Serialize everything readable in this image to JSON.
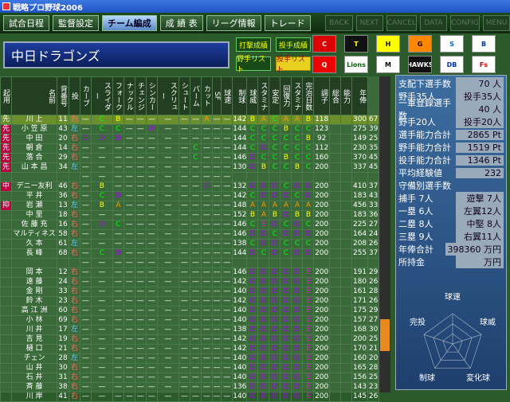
{
  "title": "戦略プロ野球2006",
  "menu": [
    "試合日程",
    "監督設定",
    "チーム編成",
    "成 績 表",
    "リーグ情報",
    "トレード"
  ],
  "active_menu": "チーム編成",
  "system_buttons": [
    "BACK",
    "NEXT",
    "CANCEL",
    "DATA",
    "CONFIG",
    "MENU"
  ],
  "team_name": "中日ドラゴンズ",
  "buttons": {
    "batter_stats": "打撃成績",
    "pitcher_stats": "投手成績",
    "batter_list": "野手リスト",
    "pitcher_list": "投手リスト"
  },
  "logos": [
    "C",
    "T",
    "H",
    "G",
    "S",
    "B",
    "Q",
    "Lions",
    "M",
    "HAWKS",
    "DB",
    "Fs"
  ],
  "headers": [
    "起用",
    "名前",
    "背番号",
    "投",
    "カーブ",
    "スライダー",
    "フォーク",
    "ナックル",
    "チェンジ",
    "シンカー",
    "スクリュー",
    "シュート",
    "パーム",
    "カット",
    "SF",
    "球速",
    "制球",
    "球威",
    "スタミナ",
    "安定",
    "回復力",
    "スタミナ",
    "完治日数",
    "調子",
    "総合",
    "能力",
    "年俸"
  ],
  "rows": [
    [
      "先",
      "川 上",
      11,
      "右",
      "",
      "C",
      "B",
      "",
      "",
      "",
      "",
      "",
      "",
      "A",
      "",
      "",
      "142",
      "B",
      "A",
      "C",
      "A",
      "A",
      "B",
      "118",
      "",
      "",
      "300",
      "67",
      "24000"
    ],
    [
      "先",
      "小 笠 原",
      43,
      "左",
      "",
      "C",
      "C",
      "",
      "",
      "D",
      "",
      "",
      "",
      "",
      "",
      "",
      "144",
      "C",
      "C",
      "C",
      "B",
      "C",
      "C",
      "123",
      "",
      "",
      "275",
      "39",
      "1800"
    ],
    [
      "先",
      "中 田",
      20,
      "右",
      "D",
      "D",
      "D",
      "",
      "",
      "",
      "",
      "",
      "",
      "",
      "",
      "",
      "144",
      "C",
      "C",
      "C",
      "C",
      "C",
      "B",
      "92",
      "",
      "",
      "149",
      "25",
      "1000"
    ],
    [
      "先",
      "朝 倉",
      14,
      "右",
      "",
      "",
      "",
      "",
      "",
      "",
      "",
      "",
      "C",
      "",
      "",
      "",
      "144",
      "C",
      "D",
      "C",
      "C",
      "C",
      "C",
      "112",
      "",
      "",
      "230",
      "35",
      "7000"
    ],
    [
      "先",
      "落 合",
      29,
      "右",
      "",
      "",
      "",
      "",
      "",
      "",
      "",
      "",
      "C",
      "",
      "",
      "",
      "146",
      "D",
      "C",
      "C",
      "B",
      "C",
      "C",
      "160",
      "",
      "",
      "370",
      "45",
      "11000"
    ],
    [
      "先",
      "山 本 昌",
      34,
      "左",
      "",
      "",
      "",
      "",
      "",
      "",
      "",
      "",
      "",
      "",
      "",
      "",
      "130",
      "D",
      "B",
      "C",
      "C",
      "B",
      "C",
      "200",
      "",
      "",
      "337",
      "45",
      "23000"
    ],
    [
      "",
      "",
      "",
      "",
      "",
      "",
      "",
      "",
      "",
      "",
      "",
      "",
      "",
      "",
      "",
      "",
      "",
      "",
      "",
      "",
      "",
      "",
      "",
      "",
      "",
      "",
      "",
      "",
      ""
    ],
    [
      "中",
      "デニー友利",
      46,
      "右",
      "",
      "B",
      "",
      "",
      "",
      "",
      "",
      "",
      "",
      "D",
      "",
      "",
      "132",
      "D",
      "D",
      "D",
      "C",
      "D",
      "D",
      "200",
      "",
      "",
      "410",
      "37",
      "4500"
    ],
    [
      "",
      "平 井",
      36,
      "右",
      "",
      "C",
      "D",
      "",
      "",
      "",
      "",
      "",
      "",
      "",
      "",
      "",
      "142",
      "C",
      "D",
      "D",
      "D",
      "C",
      "D",
      "200",
      "",
      "",
      "183",
      "43",
      "8000"
    ],
    [
      "抑",
      "岩 瀬",
      13,
      "左",
      "",
      "B",
      "A",
      "",
      "",
      "",
      "",
      "",
      "",
      "",
      "",
      "",
      "148",
      "A",
      "A",
      "A",
      "A",
      "A",
      "A",
      "200",
      "",
      "",
      "456",
      "33",
      "30500"
    ],
    [
      "",
      "中 里",
      18,
      "右",
      "",
      "",
      "",
      "",
      "",
      "",
      "",
      "",
      "",
      "",
      "",
      "",
      "152",
      "B",
      "A",
      "B",
      "D",
      "B",
      "B",
      "200",
      "",
      "",
      "183",
      "36",
      "750"
    ],
    [
      "",
      "佐 藤 充",
      16,
      "右",
      "",
      "D",
      "C",
      "",
      "",
      "",
      "",
      "",
      "",
      "",
      "",
      "",
      "146",
      "C",
      "E",
      "D",
      "C",
      "D",
      "C",
      "200",
      "",
      "",
      "225",
      "27",
      "1200"
    ],
    [
      "",
      "マルティネス",
      58,
      "右",
      "",
      "",
      "",
      "",
      "",
      "",
      "",
      "",
      "",
      "",
      "",
      "",
      "146",
      "D",
      "D",
      "C",
      "D",
      "D",
      "D",
      "200",
      "",
      "",
      "164",
      "24",
      "5750"
    ],
    [
      "",
      "久 本",
      61,
      "左",
      "",
      "",
      "",
      "",
      "",
      "",
      "",
      "",
      "",
      "",
      "",
      "",
      "138",
      "C",
      "D",
      "D",
      "C",
      "C",
      "C",
      "200",
      "",
      "",
      "208",
      "26",
      "1500"
    ],
    [
      "",
      "長 峰",
      68,
      "右",
      "",
      "C",
      "D",
      "",
      "",
      "",
      "",
      "",
      "",
      "",
      "",
      "",
      "144",
      "D",
      "C",
      "D",
      "C",
      "D",
      "D",
      "200",
      "",
      "",
      "255",
      "37",
      "2200"
    ],
    [
      "",
      "",
      "",
      "",
      "",
      "",
      "",
      "",
      "",
      "",
      "",
      "",
      "",
      "",
      "",
      "",
      "",
      "",
      "",
      "",
      "",
      "",
      "",
      "",
      "",
      "",
      "",
      "",
      ""
    ],
    [
      "",
      "岡 本",
      12,
      "右",
      "",
      "",
      "",
      "",
      "",
      "",
      "",
      "",
      "",
      "",
      "",
      "",
      "146",
      "D",
      "D",
      "D",
      "D",
      "D",
      "E",
      "200",
      "",
      "",
      "191",
      "29",
      "1600"
    ],
    [
      "",
      "遠 藤",
      24,
      "右",
      "",
      "",
      "",
      "",
      "",
      "",
      "",
      "",
      "",
      "",
      "",
      "",
      "142",
      "D",
      "D",
      "D",
      "D",
      "D",
      "E",
      "200",
      "",
      "",
      "180",
      "26",
      "1000"
    ],
    [
      "",
      "金 剛",
      33,
      "右",
      "",
      "",
      "",
      "",
      "",
      "",
      "",
      "",
      "",
      "",
      "",
      "",
      "140",
      "D",
      "D",
      "D",
      "D",
      "D",
      "E",
      "200",
      "",
      "",
      "161",
      "28",
      "800"
    ],
    [
      "",
      "鈴 木",
      23,
      "右",
      "",
      "",
      "",
      "",
      "",
      "",
      "",
      "",
      "",
      "",
      "",
      "",
      "142",
      "D",
      "D",
      "D",
      "D",
      "D",
      "E",
      "200",
      "",
      "",
      "171",
      "26",
      "900"
    ],
    [
      "",
      "高 江 洲",
      60,
      "右",
      "",
      "",
      "",
      "",
      "",
      "",
      "",
      "",
      "",
      "",
      "",
      "",
      "140",
      "D",
      "D",
      "D",
      "D",
      "D",
      "E",
      "200",
      "",
      "",
      "175",
      "29",
      "700"
    ],
    [
      "",
      "小 林",
      69,
      "右",
      "",
      "",
      "",
      "",
      "",
      "",
      "",
      "",
      "",
      "",
      "",
      "",
      "140",
      "D",
      "D",
      "D",
      "D",
      "D",
      "E",
      "200",
      "",
      "",
      "157",
      "27",
      "700"
    ],
    [
      "",
      "川 井",
      17,
      "左",
      "",
      "",
      "",
      "",
      "",
      "",
      "",
      "",
      "",
      "",
      "",
      "",
      "138",
      "D",
      "D",
      "D",
      "D",
      "D",
      "E",
      "200",
      "",
      "",
      "168",
      "30",
      "800"
    ],
    [
      "",
      "吉 見",
      19,
      "右",
      "",
      "",
      "",
      "",
      "",
      "",
      "",
      "",
      "",
      "",
      "",
      "",
      "142",
      "D",
      "D",
      "D",
      "D",
      "D",
      "E",
      "200",
      "",
      "",
      "200",
      "25",
      "1500"
    ],
    [
      "",
      "樋 口",
      21,
      "右",
      "",
      "",
      "",
      "",
      "",
      "",
      "",
      "",
      "",
      "",
      "",
      "",
      "142",
      "D",
      "D",
      "D",
      "D",
      "D",
      "E",
      "200",
      "",
      "",
      "170",
      "21",
      "1000"
    ],
    [
      "",
      "チェン",
      28,
      "左",
      "",
      "",
      "",
      "",
      "",
      "",
      "",
      "",
      "",
      "",
      "",
      "",
      "140",
      "D",
      "D",
      "D",
      "D",
      "D",
      "E",
      "200",
      "",
      "",
      "160",
      "20",
      "1000"
    ],
    [
      "",
      "山 井",
      30,
      "右",
      "",
      "",
      "",
      "",
      "",
      "",
      "",
      "",
      "",
      "",
      "",
      "",
      "140",
      "D",
      "D",
      "D",
      "D",
      "D",
      "E",
      "200",
      "",
      "",
      "165",
      "28",
      "900"
    ],
    [
      "",
      "石 井",
      31,
      "右",
      "",
      "",
      "",
      "",
      "",
      "",
      "",
      "",
      "",
      "",
      "",
      "",
      "140",
      "D",
      "D",
      "D",
      "D",
      "D",
      "E",
      "200",
      "",
      "",
      "156",
      "25",
      "800"
    ],
    [
      "",
      "斉 藤",
      38,
      "右",
      "",
      "",
      "",
      "",
      "",
      "",
      "",
      "",
      "",
      "",
      "",
      "",
      "136",
      "D",
      "D",
      "D",
      "D",
      "D",
      "E",
      "200",
      "",
      "",
      "143",
      "23",
      "700"
    ],
    [
      "",
      "川 岸",
      41,
      "右",
      "",
      "",
      "",
      "",
      "",
      "",
      "",
      "",
      "",
      "",
      "",
      "",
      "140",
      "D",
      "D",
      "D",
      "D",
      "D",
      "E",
      "200",
      "",
      "",
      "145",
      "26",
      "700"
    ]
  ],
  "panel": [
    [
      "支配下選手数",
      "70 人"
    ],
    [
      "野手35人",
      "投手35人"
    ],
    [
      "一軍登録選手数",
      "40 人"
    ],
    [
      "野手20人",
      "投手20人"
    ],
    [
      "選手能力合計",
      "2865 Pt"
    ],
    [
      "野手能力合計",
      "1519 Pt"
    ],
    [
      "投手能力合計",
      "1346 Pt"
    ],
    [
      "平均経験値",
      "232"
    ],
    [
      "守備別選手数",
      ""
    ],
    [
      "捕手 7人",
      "遊撃 7人"
    ],
    [
      "一塁 6人",
      "左翼12人"
    ],
    [
      "二塁 8人",
      "中堅 8人"
    ],
    [
      "三塁 9人",
      "右翼11人"
    ],
    [
      "年俸合計",
      "398360 万円"
    ],
    [
      "所持金",
      "万円"
    ]
  ],
  "radar_labels": [
    "球速",
    "球威",
    "変化球",
    "制球",
    "完投"
  ]
}
